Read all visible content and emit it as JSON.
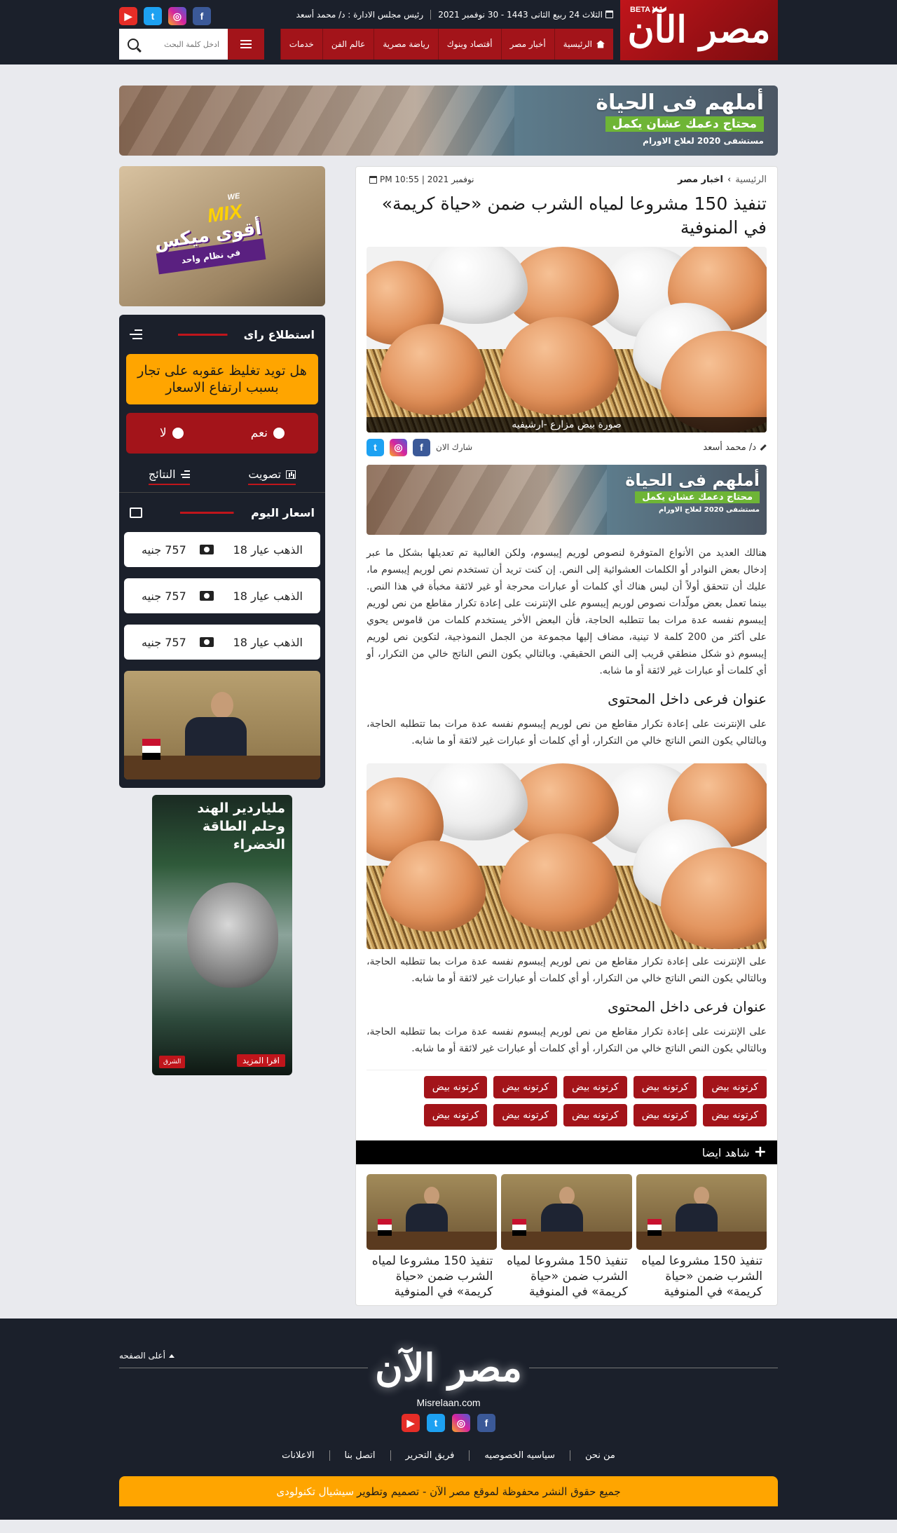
{
  "header": {
    "logo_text": "مصر الآن",
    "beta": "BETA V.1",
    "date": "الثلاث 24 ربيع الثانى 1443 - 30 نوفمبر 2021",
    "chairman": "رئيس مجلس الادارة : د/ محمد أسعد",
    "nav": [
      "الرئيسية",
      "أخبار مصر",
      "أقتصاد وبنوك",
      "رياضة مصرية",
      "عالم الفن",
      "خدمات"
    ],
    "search_placeholder": "ادخل كلمة البحث",
    "socials": [
      "youtube-icon",
      "twitter-icon",
      "instagram-icon",
      "facebook-icon"
    ]
  },
  "ad_banner": {
    "line1": "أملهم فى الحياة",
    "line2": "محتاج دعمك عشان يكمل",
    "line3": "مستشفى 2020 لعلاج الاورام"
  },
  "article": {
    "breadcrumb_home": "الرئيسية",
    "breadcrumb_cat": "اخبار مصر",
    "date": "نوفمبر 2021 | 10:55 PM",
    "title": "تنفيذ 150 مشروعا لمياه الشرب ضمن «حياة كريمة» في المنوفية",
    "image_caption": "صورة بيض مزارع -ارشيفيه",
    "author": "د/ محمد أسعد",
    "share_label": "شارك الان",
    "p1": "هنالك العديد من الأنواع المتوفرة لنصوص لوريم إيبسوم، ولكن الغالبية تم تعديلها بشكل ما عبر إدخال بعض النوادر أو الكلمات العشوائية إلى النص. إن كنت تريد أن تستخدم نص لوريم إيبسوم ما، عليك أن تتحقق أولاً أن ليس هناك أي كلمات أو عبارات محرجة أو غير لائقة مخبأة في هذا النص. بينما تعمل بعض مولّدات نصوص لوريم إيبسوم على الإنترنت على إعادة تكرار مقاطع من نص لوريم إيبسوم نفسه عدة مرات بما تتطلبه الحاجة، فأن البعض الأخر يستخدم كلمات من قاموس يحوي على أكثر من 200 كلمة لا تينية، مضاف إليها مجموعة من الجمل النموذجية، لتكوين نص لوريم إيبسوم ذو شكل منطقي قريب إلى النص الحقيقي. وبالتالي يكون النص الناتج خالي من التكرار، أو أي كلمات أو عبارات غير لائقة أو ما شابه.",
    "sub1": "عنوان فرعى داخل المحتوى",
    "p2": "على الإنترنت على إعادة تكرار مقاطع من نص لوريم إيبسوم نفسه عدة مرات بما تتطلبه الحاجة، وبالتالي يكون النص الناتج خالي من التكرار، أو أي كلمات أو عبارات غير لائقة أو ما شابه.",
    "p3": "على الإنترنت على إعادة تكرار مقاطع من نص لوريم إيبسوم نفسه عدة مرات بما تتطلبه الحاجة، وبالتالي يكون النص الناتج خالي من التكرار، أو أي كلمات أو عبارات غير لائقة أو ما شابه.",
    "sub2": "عنوان فرعى داخل المحتوى",
    "p4": "على الإنترنت على إعادة تكرار مقاطع من نص لوريم إيبسوم نفسه عدة مرات بما تتطلبه الحاجة، وبالتالي يكون النص الناتج خالي من التكرار، أو أي كلمات أو عبارات غير لائقة أو ما شابه.",
    "tags": [
      "كرتونه بيض",
      "كرتونه بيض",
      "كرتونه بيض",
      "كرتونه بيض",
      "كرتونه بيض",
      "كرتونه بيض",
      "كرتونه بيض",
      "كرتونه بيض",
      "كرتونه بيض",
      "كرتونه بيض"
    ]
  },
  "see_also": {
    "label": "شاهد ايضا",
    "items": [
      {
        "title": "تنفيذ 150 مشروعا لمياه الشرب ضمن «حياة كريمة» في المنوفية"
      },
      {
        "title": "تنفيذ 150 مشروعا لمياه الشرب ضمن «حياة كريمة» في المنوفية"
      },
      {
        "title": "تنفيذ 150 مشروعا لمياه الشرب ضمن «حياة كريمة» في المنوفية"
      }
    ]
  },
  "sidebar": {
    "ad1_brand": "MIX",
    "ad1_brand_small": "WE",
    "ad1_line1": "أقوى ميكس",
    "ad1_line2": "في نظام واحد",
    "poll": {
      "title": "استطلاع راى",
      "question": "هل تويد تغليظ عقوبه على تجار بسبب ارتفاع الاسعار",
      "yes": "نعم",
      "no": "لا",
      "vote": "تصويت",
      "results": "النتائج"
    },
    "prices": {
      "title": "اسعار اليوم",
      "rows": [
        {
          "label": "الذهب عيار 18",
          "value": "757 جنيه"
        },
        {
          "label": "الذهب عيار 18",
          "value": "757 جنيه"
        },
        {
          "label": "الذهب عيار 18",
          "value": "757 جنيه"
        }
      ]
    },
    "ad2_title": "ملياردير الهند وحلم الطاقة الخضراء",
    "ad2_read_more": "اقرا المزيد",
    "ad2_brand": "الشرق"
  },
  "footer": {
    "logo_text": "مصر الآن",
    "back_to_top": "أعلى الصفحه",
    "site": "Misrelaan.com",
    "links": [
      "من نحن",
      "سياسيه الخصوصيه",
      "فريق التحرير",
      "اتصل بنا",
      "الاعلانات"
    ],
    "copyright": "جميع حقوق النشر محفوظة لموقع مصر الآن - تصميم وتطوير",
    "developer": "سيشيال تكنولودى"
  },
  "colors": {
    "brand_red": "#a3141a",
    "dark": "#1b202b",
    "accent_orange": "#ffa500"
  }
}
